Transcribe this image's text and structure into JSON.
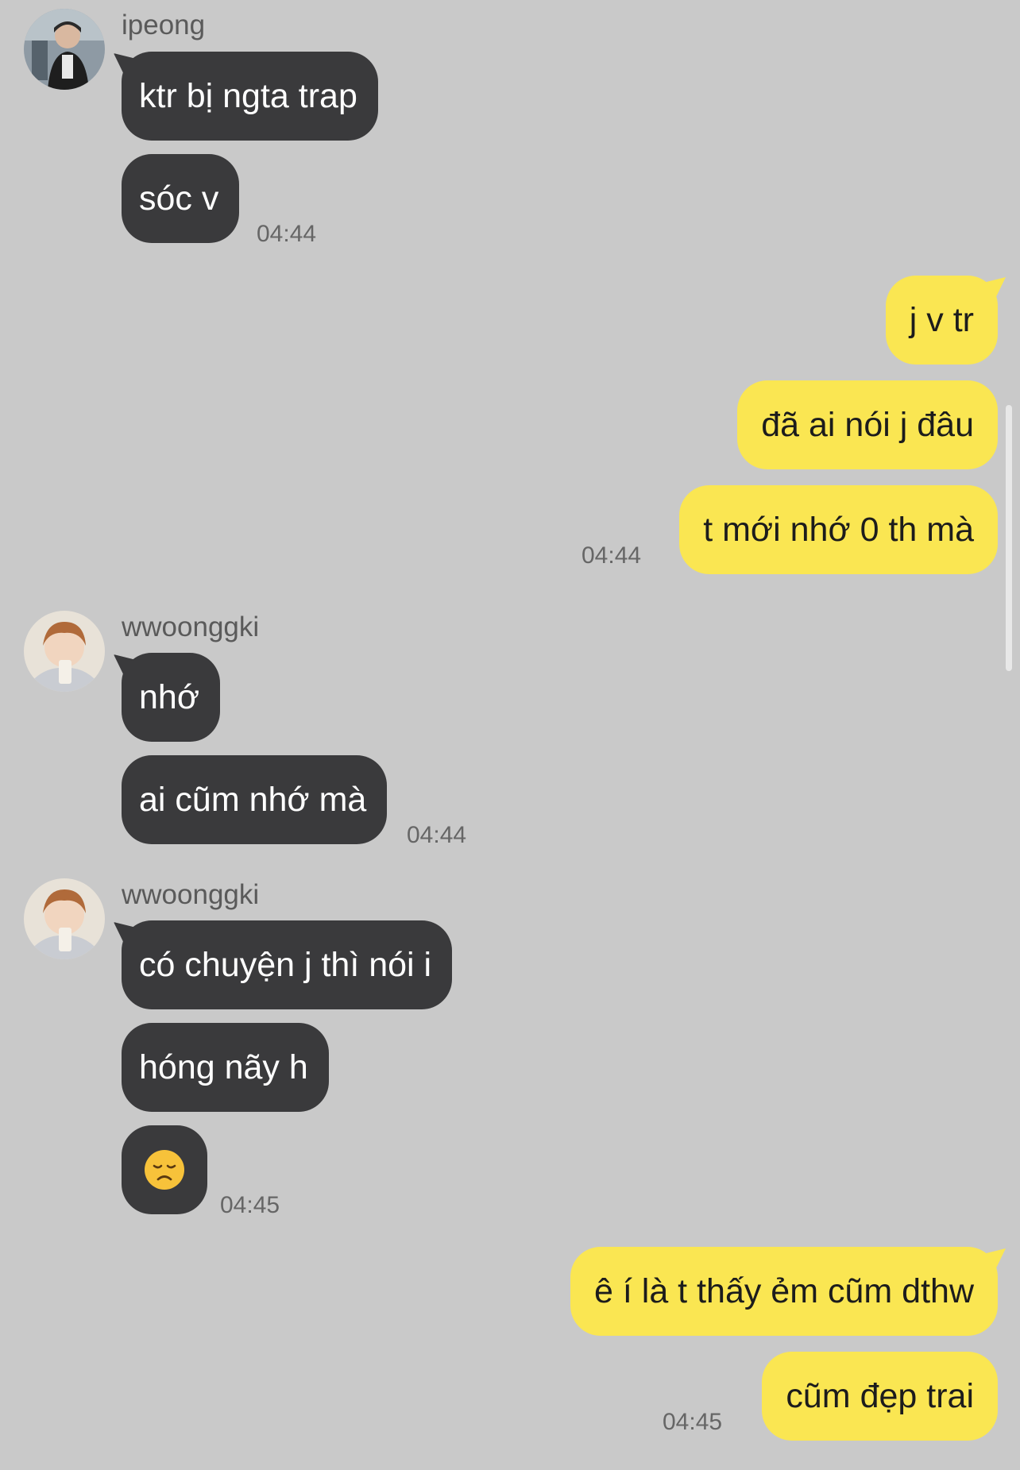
{
  "groups": [
    {
      "sender": "ipeong",
      "messages": [
        "ktr bị ngta trap",
        "sóc v"
      ],
      "time": "04:44"
    },
    {
      "sender": "",
      "outgoing": true,
      "messages": [
        "j v tr",
        "đã ai nói j đâu",
        "t mới nhớ 0 th mà"
      ],
      "time": "04:44"
    },
    {
      "sender": "wwoonggki",
      "messages": [
        "nhớ",
        "ai cũm nhớ mà"
      ],
      "time": "04:44"
    },
    {
      "sender": "wwoonggki",
      "messages": [
        "có chuyện j thì nói i",
        "hóng nãy h",
        "😞"
      ],
      "emoji_icon": "disappointed-face-icon",
      "time": "04:45"
    },
    {
      "sender": "",
      "outgoing": true,
      "messages": [
        "ê í là t thấy ẻm cũm dthw",
        "cũm đẹp trai"
      ],
      "time": "04:45"
    }
  ],
  "colors": {
    "background": "#c9c9c9",
    "incoming_bubble": "#3a3a3c",
    "outgoing_bubble": "#fae652"
  }
}
